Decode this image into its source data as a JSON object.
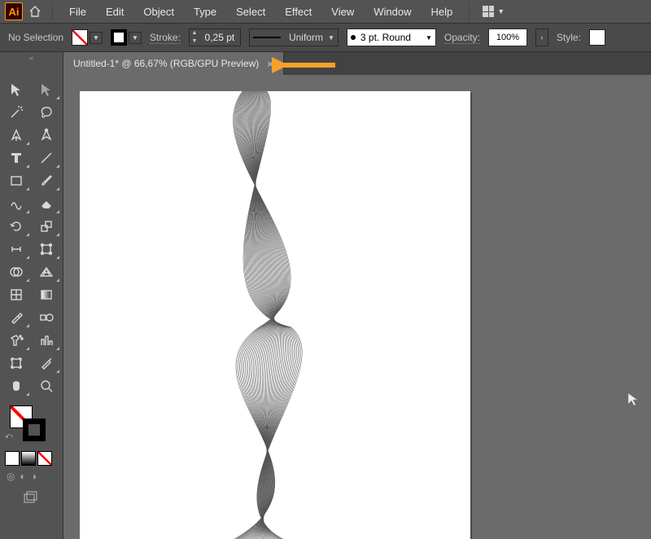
{
  "menu": {
    "items": [
      "File",
      "Edit",
      "Object",
      "Type",
      "Select",
      "Effect",
      "View",
      "Window",
      "Help"
    ]
  },
  "control": {
    "selection_status": "No Selection",
    "stroke_label": "Stroke:",
    "stroke_value": "0,25 pt",
    "profile_label": "Uniform",
    "brush_label": "3 pt. Round",
    "opacity_label": "Opacity:",
    "opacity_value": "100%",
    "style_label": "Style:"
  },
  "tab": {
    "title": "Untitled-1* @ 66,67% (RGB/GPU Preview)"
  },
  "toolbox_word": ""
}
